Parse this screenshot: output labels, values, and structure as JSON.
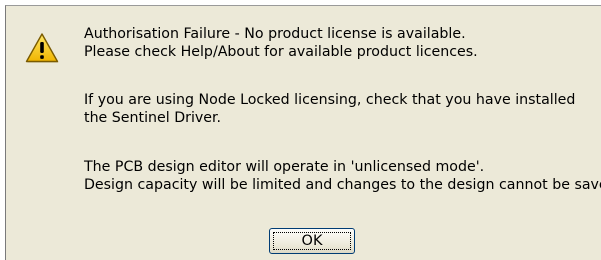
{
  "dialog": {
    "icon": "warning-icon",
    "message_lines": [
      "Authorisation Failure - No product license is available.",
      "Please check Help/About for available product licences.",
      "If you are using Node Locked licensing, check that you have installed",
      "the Sentinel Driver.",
      "The PCB design editor will operate in 'unlicensed mode'.",
      "Design capacity will be limited and changes to the design cannot be saved."
    ],
    "ok_label": "OK",
    "colors": {
      "dialog_background": "#ECE9D8",
      "warning_yellow": "#F5C400",
      "button_border": "#003C74"
    }
  }
}
